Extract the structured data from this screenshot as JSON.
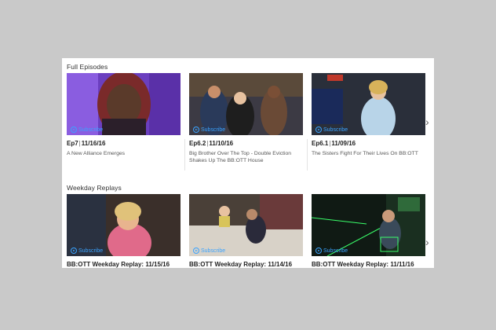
{
  "sections": {
    "full_episodes": {
      "title": "Full Episodes",
      "cards": [
        {
          "episode": "Ep7",
          "date": "11/16/16",
          "title": "A New Alliance Emerges",
          "subscribe": "Subscribe"
        },
        {
          "episode": "Ep6.2",
          "date": "11/10/16",
          "title": "Big Brother Over The Top - Double Eviction Shakes Up The BB:OTT House",
          "subscribe": "Subscribe"
        },
        {
          "episode": "Ep6.1",
          "date": "11/09/16",
          "title": "The Sisters Fight For Their Lives On BB:OTT",
          "subscribe": "Subscribe"
        }
      ]
    },
    "weekday_replays": {
      "title": "Weekday Replays",
      "cards": [
        {
          "title": "BB:OTT Weekday Replay: 11/15/16",
          "subscribe": "Subscribe"
        },
        {
          "title": "BB:OTT Weekday Replay: 11/14/16",
          "subscribe": "Subscribe"
        },
        {
          "title": "BB:OTT Weekday Replay: 11/11/16",
          "subscribe": "Subscribe"
        }
      ]
    }
  },
  "icons": {
    "next": "chevron-right-icon",
    "play": "play-circle-icon"
  },
  "colors": {
    "accent": "#3aa3ff",
    "background": "#c9c9c9",
    "panel": "#ffffff"
  }
}
